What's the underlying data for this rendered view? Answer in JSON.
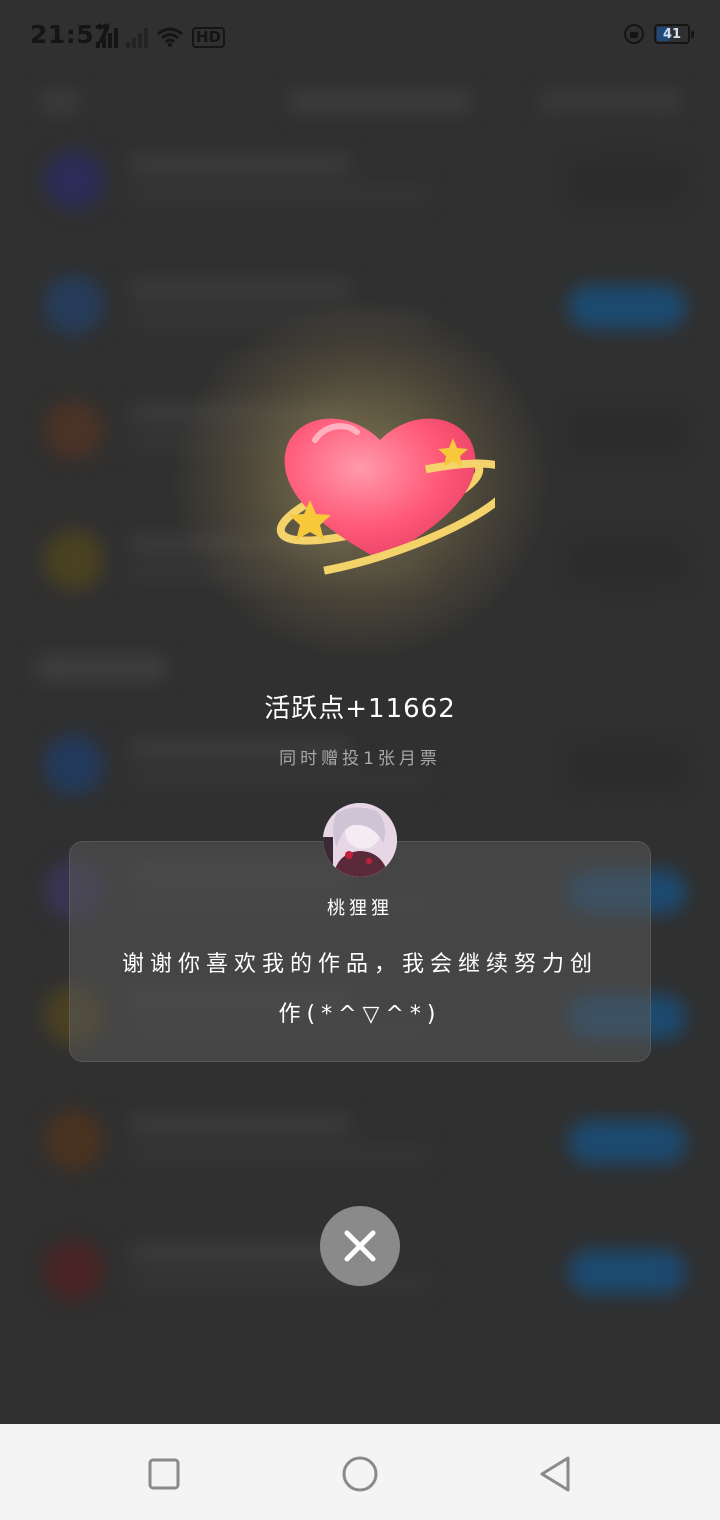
{
  "status_bar": {
    "time": "21:57",
    "network_label": "4G",
    "hd_label": "HD",
    "battery": "41"
  },
  "reward": {
    "points_text": "活跃点+11662",
    "sub_text": "同时赠投1张月票"
  },
  "author": {
    "name": "桃狸狸",
    "message": "谢谢你喜欢我的作品，我会继续努力创作(*^▽^*)"
  },
  "colors": {
    "overlay": "#303030",
    "card": "#585858",
    "close_button": "#8a8a8a",
    "heart": "#ff5a78",
    "ring": "#f5d36a",
    "nav_bar": "#f4f4f4"
  },
  "icons": {
    "close": "close-icon",
    "nav_recent": "square-icon",
    "nav_home": "circle-icon",
    "nav_back": "triangle-back-icon"
  }
}
